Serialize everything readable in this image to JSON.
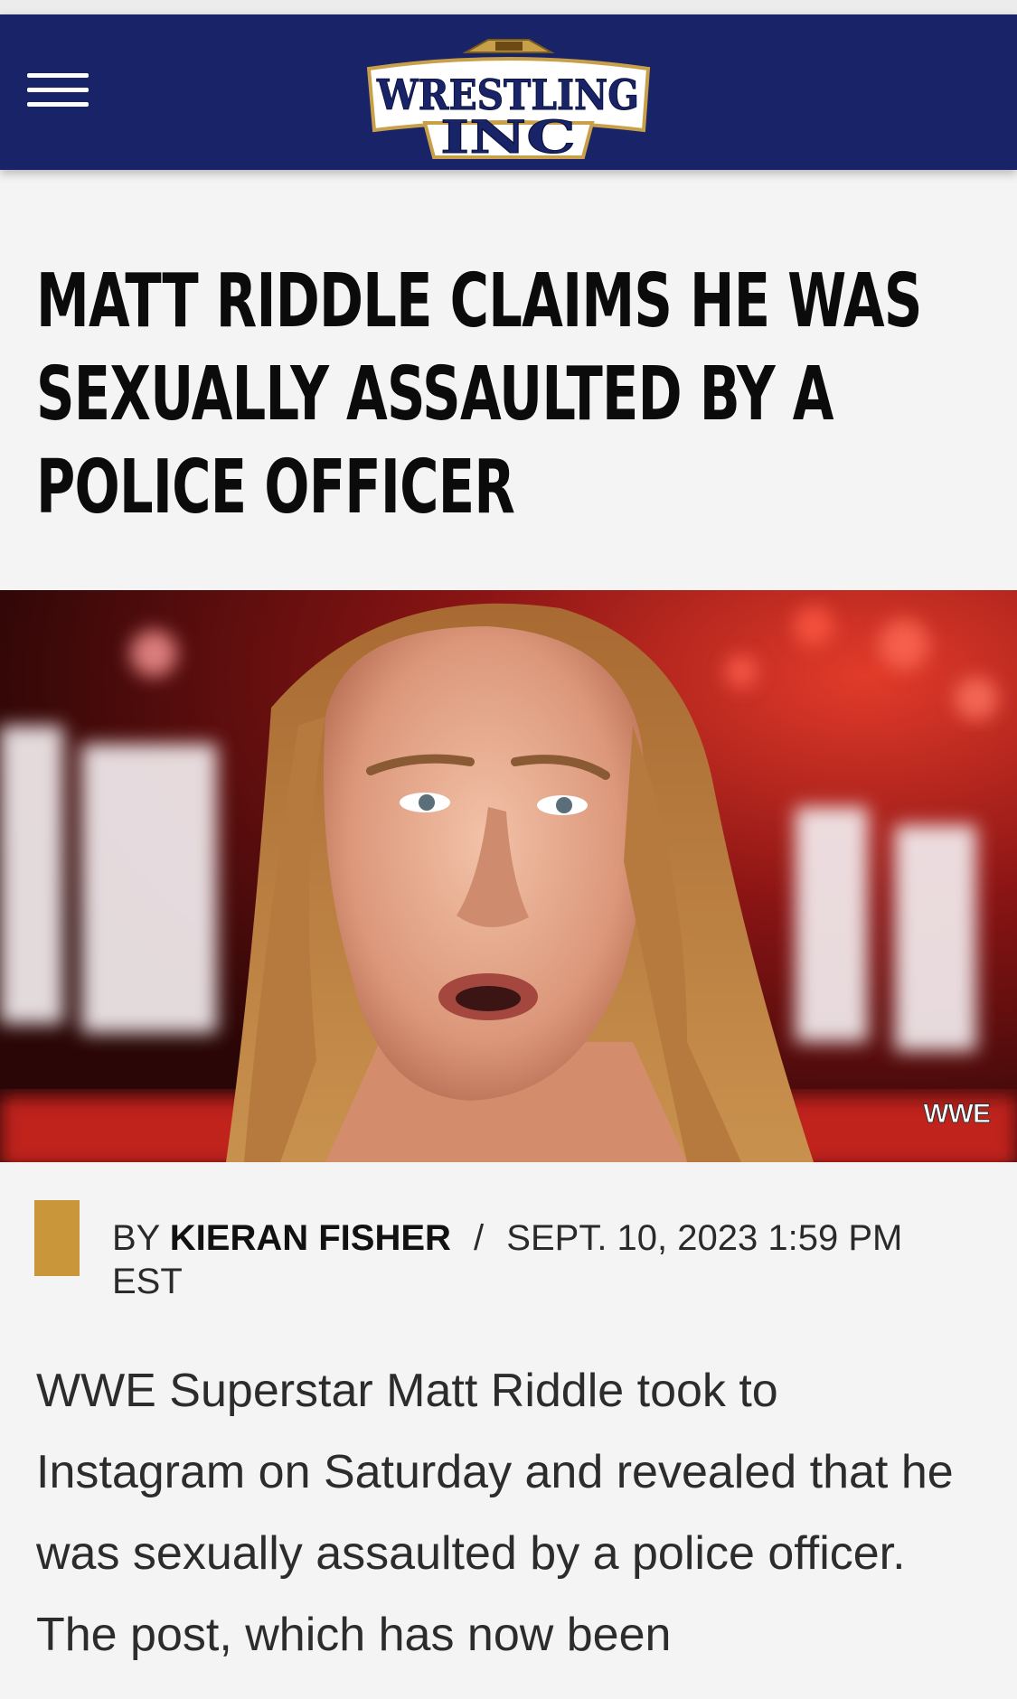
{
  "header": {
    "logo_line1": "WRESTLING",
    "logo_line2": "INC",
    "colors": {
      "background": "#182467",
      "logo_gold": "#c9a04a"
    }
  },
  "article": {
    "title": "MATT RIDDLE CLAIMS HE WAS SEXUALLY ASSAULTED BY A POLICE OFFICER",
    "title_lines": [
      "MATT RIDDLE CLAIMS HE WAS",
      "SEXUALLY ASSAULTED BY A",
      "POLICE OFFICER"
    ],
    "image_credit": "WWE",
    "byline": {
      "by_label": "BY",
      "author": "KIERAN FISHER",
      "separator": "/",
      "date": "SEPT. 10, 2023 1:59 PM EST",
      "accent_color": "#c9963a"
    },
    "body_text": "WWE Superstar Matt Riddle took to Instagram on Saturday and revealed that he was sexually assaulted by a police officer. The post, which has now been"
  }
}
